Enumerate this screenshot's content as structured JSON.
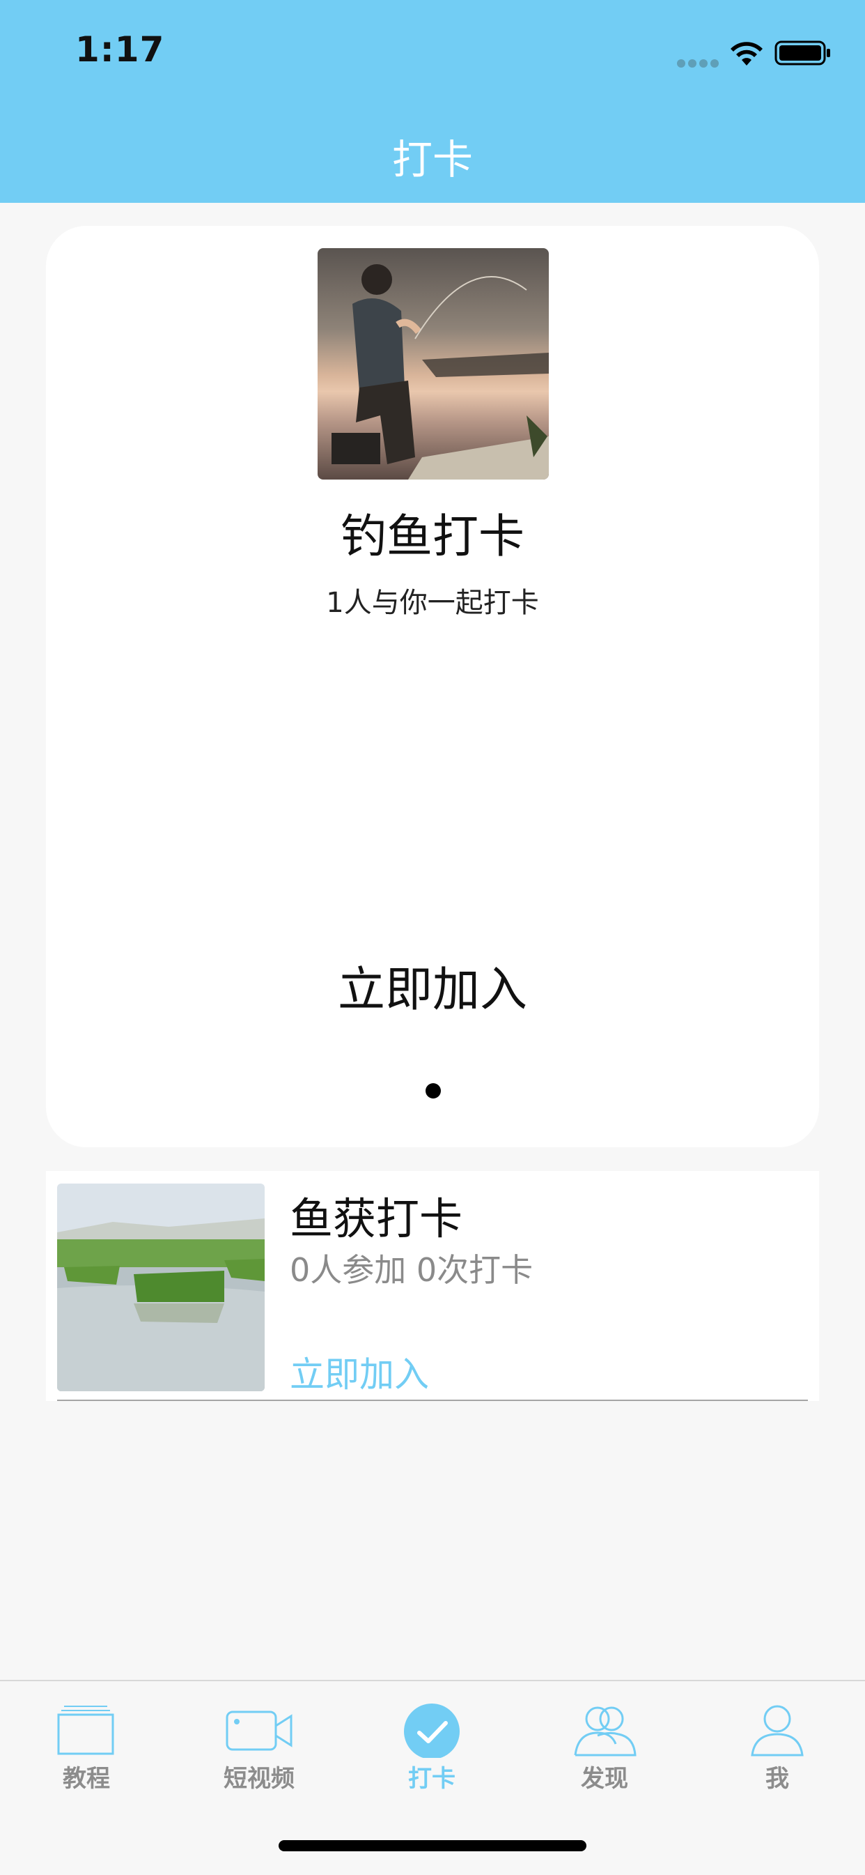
{
  "status_bar": {
    "time": "1:17"
  },
  "nav": {
    "title": "打卡"
  },
  "featured": {
    "title": "钓鱼打卡",
    "subtitle": "1人与你一起打卡",
    "join_label": "立即加入"
  },
  "list": [
    {
      "title": "鱼获打卡",
      "meta": "0人参加 0次打卡",
      "join_label": "立即加入"
    }
  ],
  "tabs": [
    {
      "label": "教程",
      "icon": "book-icon"
    },
    {
      "label": "短视频",
      "icon": "video-camera-icon"
    },
    {
      "label": "打卡",
      "icon": "checkmark-circle-icon"
    },
    {
      "label": "发现",
      "icon": "people-icon"
    },
    {
      "label": "我",
      "icon": "person-icon"
    }
  ],
  "colors": {
    "accent": "#72cdf4",
    "background": "#f7f7f7"
  }
}
